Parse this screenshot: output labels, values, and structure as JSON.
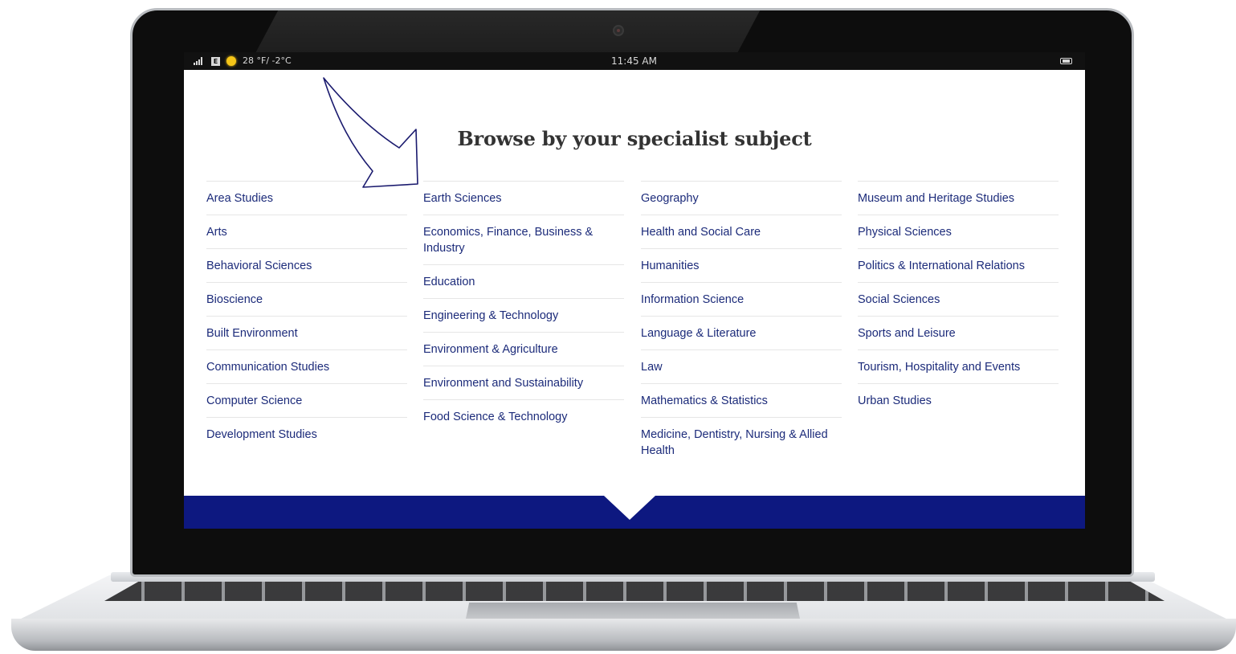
{
  "status_bar": {
    "signal_icon": "signal-bars-icon",
    "badge_icon": "e-badge-icon",
    "badge_letter": "E",
    "weather_icon": "sun-icon",
    "temperature": "28 °F/ -2°C",
    "time": "11:45 AM",
    "battery_icon": "battery-icon"
  },
  "page": {
    "heading": "Browse by your specialist subject"
  },
  "subject_columns": [
    {
      "items": [
        "Area Studies",
        "Arts",
        "Behavioral Sciences",
        "Bioscience",
        "Built Environment",
        "Communication Studies",
        "Computer Science",
        "Development Studies"
      ]
    },
    {
      "items": [
        "Earth Sciences",
        "Economics, Finance, Business & Industry",
        "Education",
        "Engineering & Technology",
        "Environment & Agriculture",
        "Environment and Sustainability",
        "Food Science & Technology"
      ]
    },
    {
      "items": [
        "Geography",
        "Health and Social Care",
        "Humanities",
        "Information Science",
        "Language & Literature",
        "Law",
        "Mathematics & Statistics",
        "Medicine, Dentistry, Nursing & Allied Health"
      ]
    },
    {
      "items": [
        "Museum and Heritage Studies",
        "Physical Sciences",
        "Politics & International Relations",
        "Social Sciences",
        "Sports and Leisure",
        "Tourism, Hospitality and Events",
        "Urban Studies"
      ]
    }
  ],
  "colors": {
    "link": "#1c2b7a",
    "footer_band": "#0d1880",
    "heading": "#333333",
    "divider": "#e6e6e6",
    "annotation_arrow": "#1a1a6e"
  },
  "annotation": {
    "arrow_icon": "pointer-arrow-icon"
  }
}
